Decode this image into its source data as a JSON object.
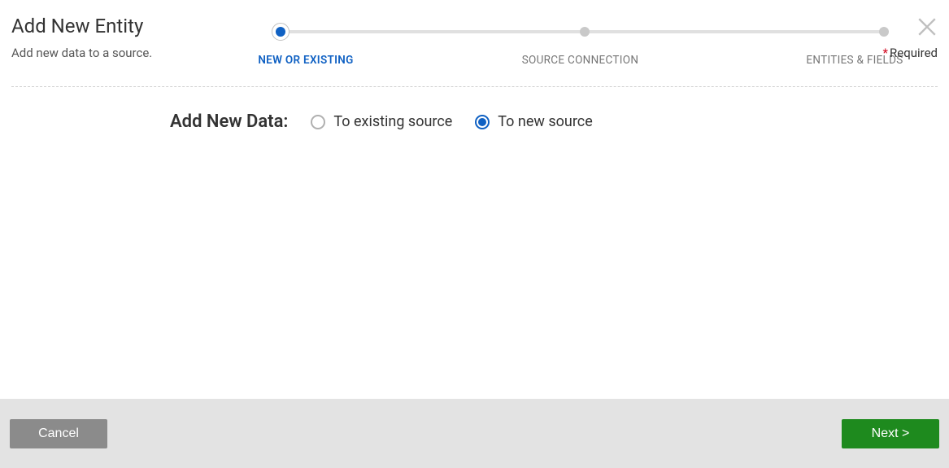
{
  "header": {
    "title": "Add New Entity",
    "subtitle": "Add new data to a source.",
    "required_label": "Required"
  },
  "stepper": {
    "steps": [
      {
        "label": "NEW OR EXISTING",
        "active": true
      },
      {
        "label": "SOURCE CONNECTION",
        "active": false
      },
      {
        "label": "ENTITIES & FIELDS",
        "active": false
      }
    ]
  },
  "form": {
    "prompt": "Add New Data:",
    "options": [
      {
        "label": "To existing source",
        "selected": false
      },
      {
        "label": "To new source",
        "selected": true
      }
    ]
  },
  "footer": {
    "cancel_label": "Cancel",
    "next_label": "Next >"
  }
}
